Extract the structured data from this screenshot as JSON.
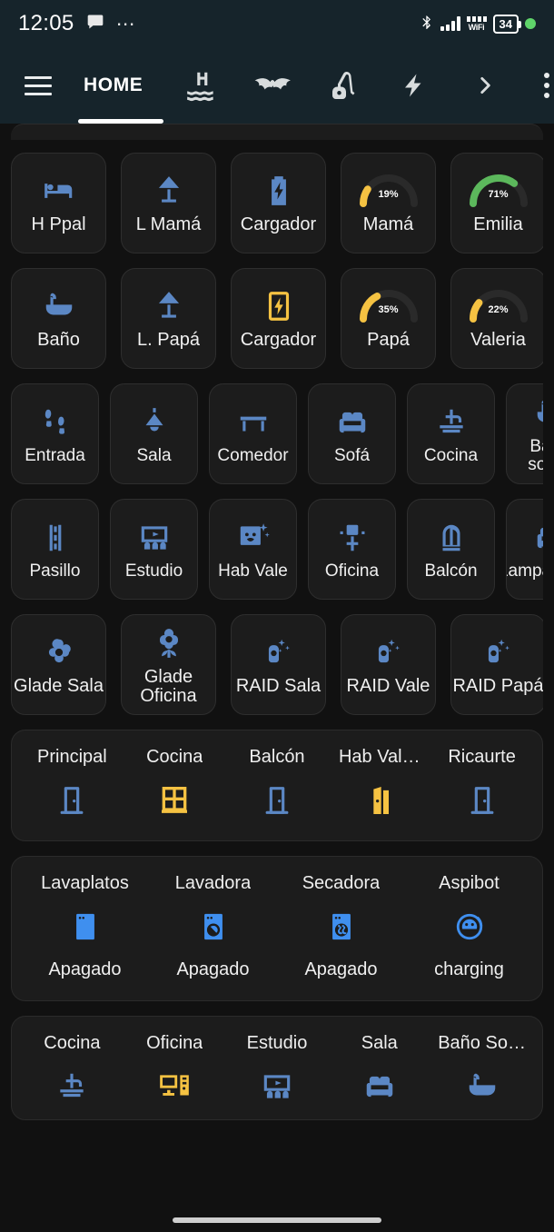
{
  "statusbar": {
    "time": "12:05",
    "overflow_dots": "⋯",
    "wifi_label": "WiFi",
    "battery_level": "34",
    "icons": [
      "chat-bubble-icon",
      "bluetooth-icon",
      "cell-signal-icon",
      "wifi-icon",
      "battery-icon",
      "recording-dot-icon"
    ]
  },
  "tabbar": {
    "menu_icon": "hamburger-menu-icon",
    "home_label": "HOME",
    "tabs": [
      {
        "name": "pool-icon"
      },
      {
        "name": "bat-icon"
      },
      {
        "name": "vacuum-icon"
      },
      {
        "name": "lightning-bolt-icon"
      },
      {
        "name": "chevron-right-icon"
      }
    ],
    "overflow_icon": "kebab-menu-icon"
  },
  "accent": {
    "blue": "#5b87c4",
    "bright_blue": "#3f8fef",
    "yellow": "#f5c242",
    "green": "#5cb85c",
    "card_bg": "#1c1c1c",
    "page_bg": "#111111",
    "header_bg": "#16242b"
  },
  "grid_rows": [
    [
      {
        "label": "H Ppal",
        "icon": "bed-icon",
        "color": "blue"
      },
      {
        "label": "L Mamá",
        "icon": "lamp-icon",
        "color": "blue"
      },
      {
        "label": "Cargador",
        "icon": "battery-charging-icon",
        "color": "blue"
      },
      {
        "label": "Mamá",
        "icon": "gauge-icon",
        "color": "yellow",
        "value": "19%",
        "pct": 19
      },
      {
        "label": "Emilia",
        "icon": "gauge-icon",
        "color": "green",
        "value": "71%",
        "pct": 71
      }
    ],
    [
      {
        "label": "Baño",
        "icon": "bathtub-icon",
        "color": "blue"
      },
      {
        "label": "L. Papá",
        "icon": "lamp-icon",
        "color": "blue"
      },
      {
        "label": "Cargador",
        "icon": "phone-charging-icon",
        "color": "yellow"
      },
      {
        "label": "Papá",
        "icon": "gauge-icon",
        "color": "yellow",
        "value": "35%",
        "pct": 35
      },
      {
        "label": "Valeria",
        "icon": "gauge-icon",
        "color": "yellow",
        "value": "22%",
        "pct": 22
      }
    ],
    [
      {
        "label": "Entrada",
        "icon": "footprints-icon",
        "color": "blue"
      },
      {
        "label": "Sala",
        "icon": "ceiling-light-icon",
        "color": "blue"
      },
      {
        "label": "Comedor",
        "icon": "table-icon",
        "color": "blue"
      },
      {
        "label": "Sofá",
        "icon": "sofa-icon",
        "color": "blue"
      },
      {
        "label": "Cocina",
        "icon": "faucet-icon",
        "color": "blue"
      },
      {
        "label": "Baño social",
        "icon": "bathtub-icon",
        "color": "blue",
        "two_line": true
      }
    ],
    [
      {
        "label": "Pasillo",
        "icon": "hallway-icon",
        "color": "blue"
      },
      {
        "label": "Estudio",
        "icon": "projector-screen-icon",
        "color": "blue"
      },
      {
        "label": "Hab Vale",
        "icon": "child-room-icon",
        "color": "blue",
        "two_line": true
      },
      {
        "label": "Oficina",
        "icon": "office-chair-icon",
        "color": "blue"
      },
      {
        "label": "Balcón",
        "icon": "window-arch-icon",
        "color": "blue"
      },
      {
        "label": "LamparaSala",
        "icon": "sofa-icon",
        "color": "blue"
      }
    ],
    [
      {
        "label": "Glade Sala",
        "icon": "flower-icon",
        "color": "blue",
        "two_line": true
      },
      {
        "label": "Glade Oficina",
        "icon": "flower-stem-icon",
        "color": "blue",
        "two_line": true
      },
      {
        "label": "RAID Sala",
        "icon": "spray-can-icon",
        "color": "blue",
        "two_line": true
      },
      {
        "label": "RAID Vale",
        "icon": "spray-can-icon",
        "color": "blue",
        "two_line": true
      },
      {
        "label": "RAID Papá",
        "icon": "spray-can-icon",
        "color": "blue",
        "two_line": true
      }
    ]
  ],
  "doors_card": {
    "items": [
      {
        "name": "Principal",
        "icon": "door-closed-icon",
        "color": "blue"
      },
      {
        "name": "Cocina",
        "icon": "window-open-icon",
        "color": "yellow"
      },
      {
        "name": "Balcón",
        "icon": "door-closed-icon",
        "color": "blue"
      },
      {
        "name": "Hab Val…",
        "icon": "door-open-icon",
        "color": "yellow"
      },
      {
        "name": "Ricaurte",
        "icon": "door-closed-icon",
        "color": "blue"
      }
    ]
  },
  "appliances_card": {
    "items": [
      {
        "name": "Lavaplatos",
        "icon": "dishwasher-icon",
        "state": "Apagado",
        "color": "bright_blue"
      },
      {
        "name": "Lavadora",
        "icon": "washer-icon",
        "state": "Apagado",
        "color": "bright_blue"
      },
      {
        "name": "Secadora",
        "icon": "dryer-icon",
        "state": "Apagado",
        "color": "bright_blue"
      },
      {
        "name": "Aspibot",
        "icon": "robot-vacuum-icon",
        "state": "charging",
        "color": "bright_blue"
      }
    ]
  },
  "rooms_card": {
    "items": [
      {
        "name": "Cocina",
        "icon": "faucet-icon",
        "color": "blue"
      },
      {
        "name": "Oficina",
        "icon": "desktop-computer-icon",
        "color": "yellow"
      },
      {
        "name": "Estudio",
        "icon": "projector-screen-icon",
        "color": "blue"
      },
      {
        "name": "Sala",
        "icon": "sofa-icon",
        "color": "blue"
      },
      {
        "name": "Baño So…",
        "icon": "bathtub-icon",
        "color": "blue"
      }
    ]
  }
}
